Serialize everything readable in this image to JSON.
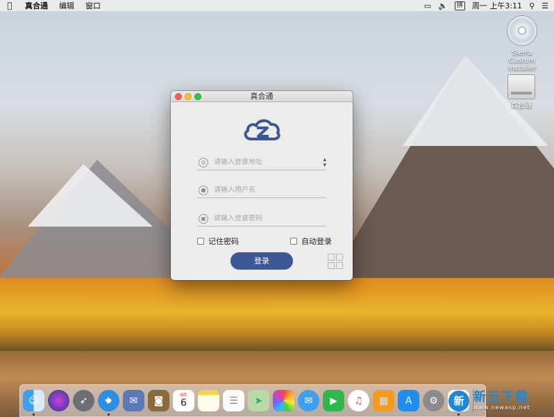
{
  "menubar": {
    "apple_icon": "apple-icon",
    "app_name": "真合通",
    "items": [
      "编辑",
      "窗口"
    ],
    "ime": "拼",
    "clock": "周一 上午3:11"
  },
  "desktop_icons": [
    {
      "label": "Sierra Custom Installer",
      "icon": "dvd-icon"
    },
    {
      "label": "真合通",
      "icon": "disk-icon"
    }
  ],
  "window": {
    "title": "真合通",
    "server_field": {
      "placeholder": "请输入登录地址",
      "value": ""
    },
    "user_field": {
      "placeholder": "请输入用户名",
      "value": ""
    },
    "password_field": {
      "placeholder": "请输入登录密码",
      "value": ""
    },
    "remember_password_label": "记住密码",
    "auto_login_label": "自动登录",
    "login_button_label": "登录",
    "brand_color": "#3b5795"
  },
  "calendar": {
    "month": "8月",
    "day": "6"
  },
  "watermark": {
    "title": "新云下载",
    "url": "www.newasp.net"
  }
}
